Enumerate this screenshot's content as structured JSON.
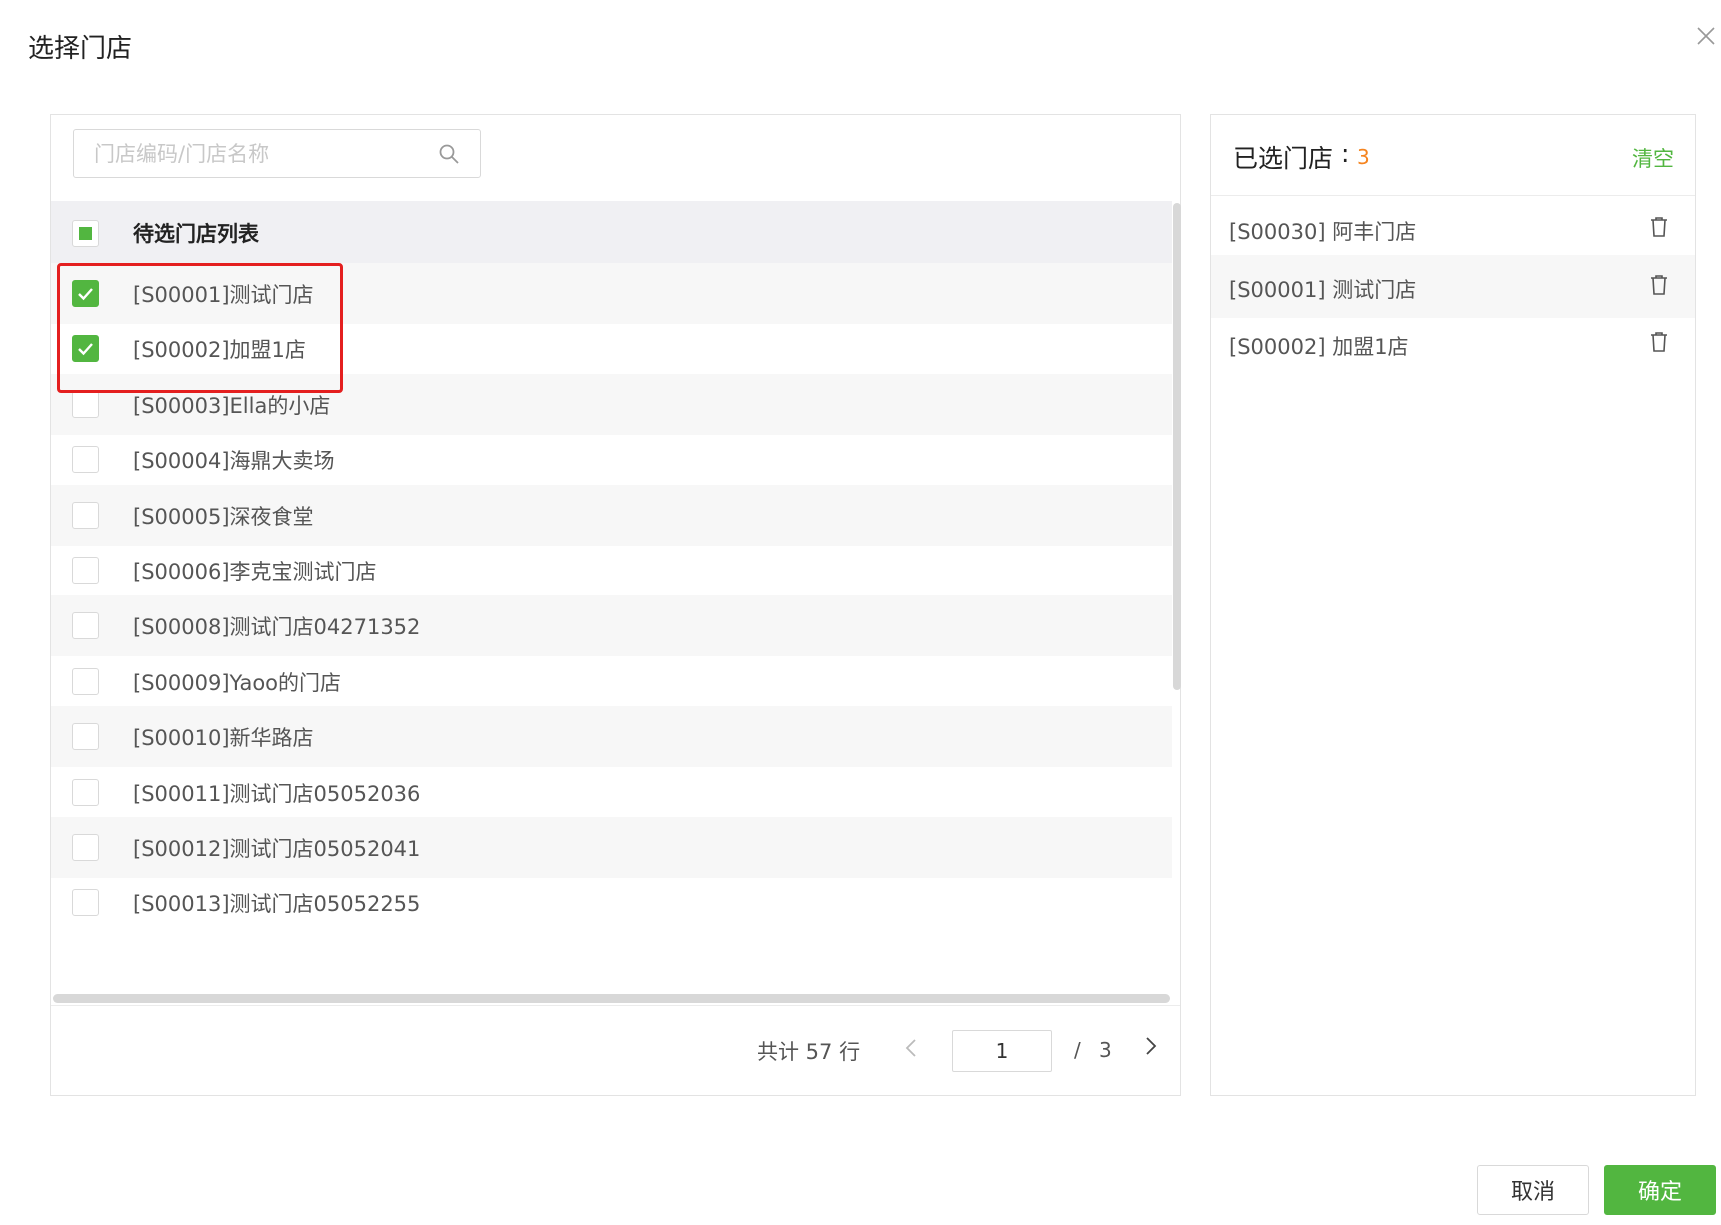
{
  "dialog": {
    "title": "选择门店"
  },
  "search": {
    "placeholder": "门店编码/门店名称"
  },
  "list": {
    "header": "待选门店列表",
    "header_state": "indeterminate",
    "rows": [
      {
        "label": "[S00001]测试门店",
        "checked": true
      },
      {
        "label": "[S00002]加盟1店",
        "checked": true
      },
      {
        "label": "[S00003]Ella的小店",
        "checked": false
      },
      {
        "label": "[S00004]海鼎大卖场",
        "checked": false
      },
      {
        "label": "[S00005]深夜食堂",
        "checked": false
      },
      {
        "label": "[S00006]李克宝测试门店",
        "checked": false
      },
      {
        "label": "[S00008]测试门店04271352",
        "checked": false
      },
      {
        "label": "[S00009]Yaoo的门店",
        "checked": false
      },
      {
        "label": "[S00010]新华路店",
        "checked": false
      },
      {
        "label": "[S00011]测试门店05052036",
        "checked": false
      },
      {
        "label": "[S00012]测试门店05052041",
        "checked": false
      },
      {
        "label": "[S00013]测试门店05052255",
        "checked": false
      }
    ]
  },
  "pagination": {
    "total_label": "共计 57 行",
    "current_page": "1",
    "separator": "/",
    "total_pages": "3"
  },
  "selected": {
    "title": "已选门店",
    "colon": ":",
    "count": "3",
    "clear_label": "清空",
    "items": [
      {
        "label": "[S00030] 阿丰门店"
      },
      {
        "label": "[S00001] 测试门店"
      },
      {
        "label": "[S00002] 加盟1店"
      }
    ]
  },
  "footer": {
    "cancel_label": "取消",
    "ok_label": "确定"
  },
  "colors": {
    "accent": "#52b640",
    "count": "#f5841f",
    "highlight": "#e41f1f"
  }
}
